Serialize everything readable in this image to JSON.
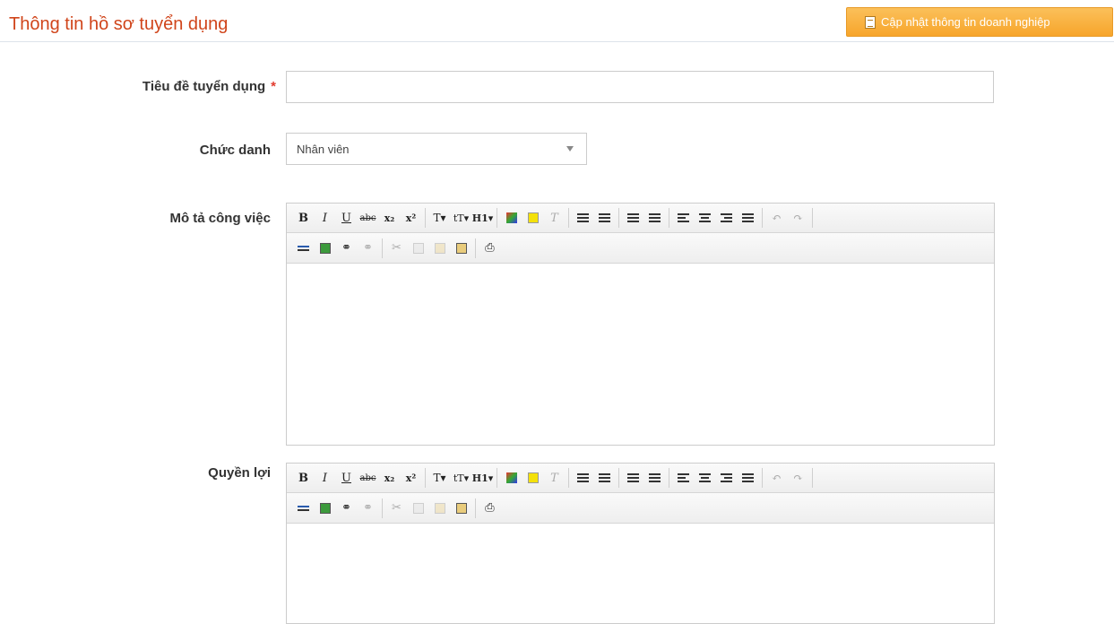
{
  "header": {
    "title": "Thông tin hồ sơ tuyển dụng",
    "update_button": "Cập nhật thông tin doanh nghiệp"
  },
  "form": {
    "title_label": "Tiêu đề tuyển dụng",
    "required_mark": "*",
    "title_value": "",
    "position_label": "Chức danh",
    "position_value": "Nhân viên",
    "description_label": "Mô tả công việc",
    "benefits_label": "Quyền lợi"
  },
  "toolbar": {
    "bold": "B",
    "italic": "I",
    "underline": "U",
    "strike": "abc",
    "subscript": "x₂",
    "superscript": "x²",
    "font": "T▾",
    "font_size": "tT▾",
    "heading": "H1▾"
  },
  "colors": {
    "title": "#d0451b",
    "button": "#f7a52b",
    "required": "#e23b2e"
  }
}
